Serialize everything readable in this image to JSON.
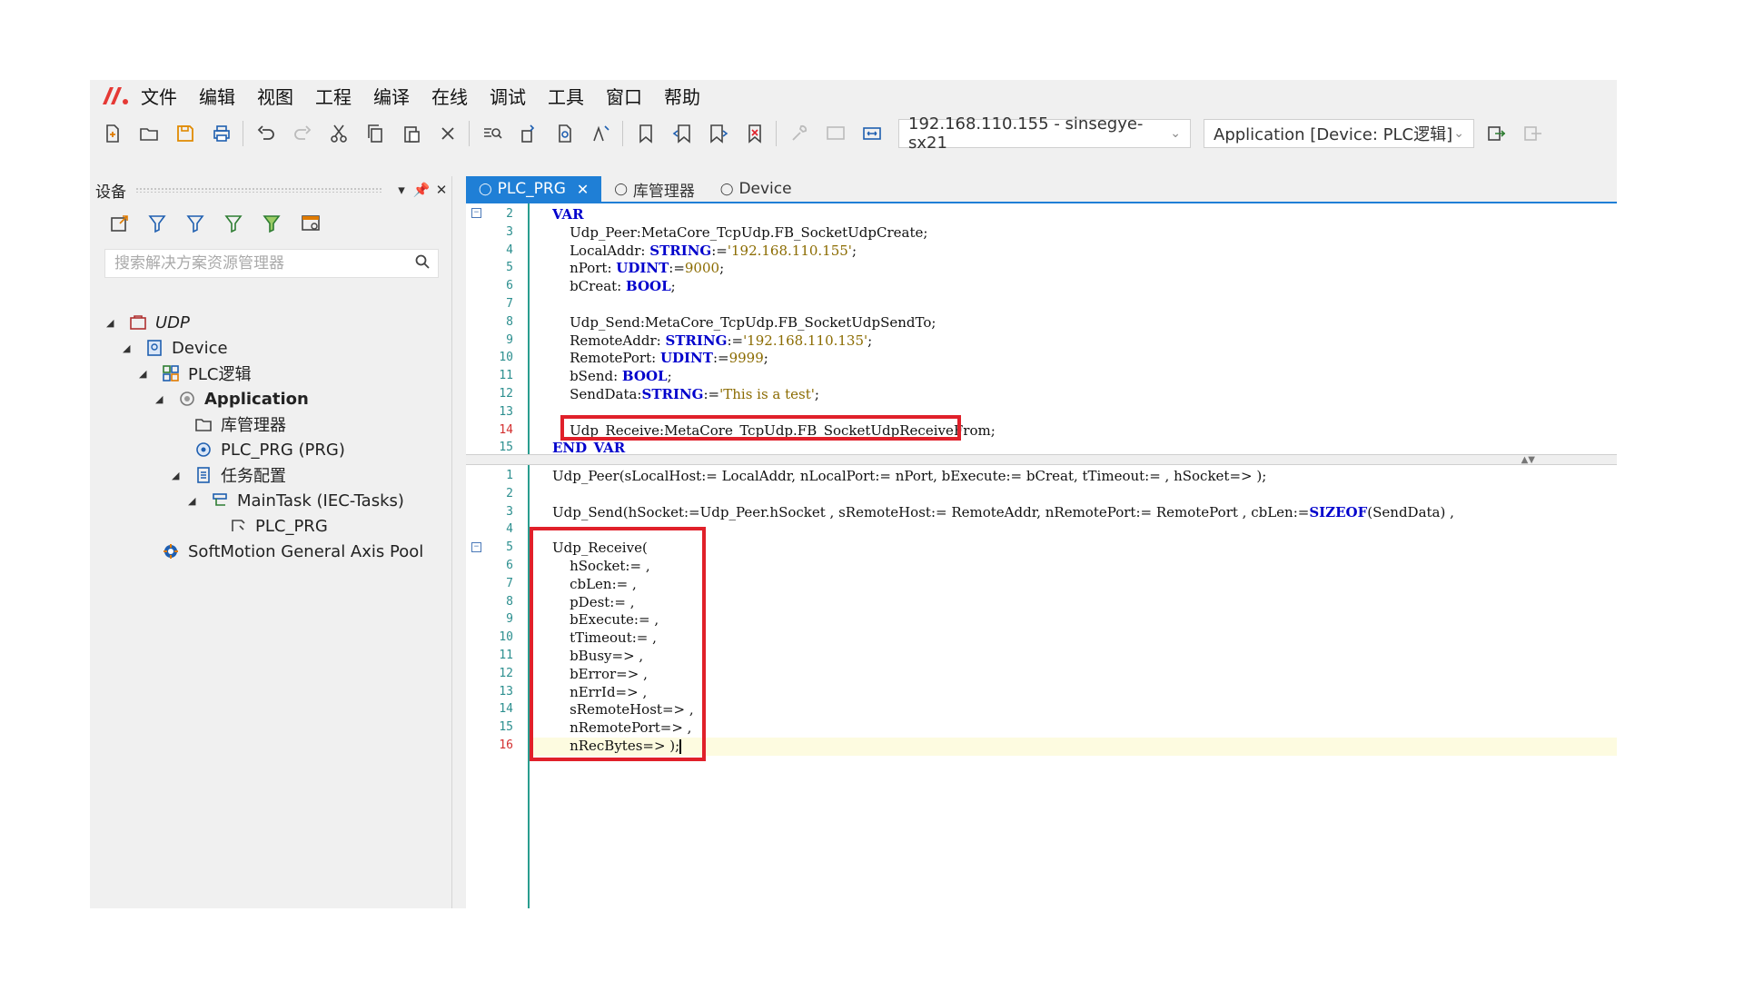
{
  "menubar": {
    "items": [
      "文件",
      "编辑",
      "视图",
      "工程",
      "编译",
      "在线",
      "调试",
      "工具",
      "窗口",
      "帮助"
    ]
  },
  "toolbar": {
    "device_combo": "192.168.110.155 - sinsegye-sx21",
    "app_combo": "Application [Device: PLC逻辑]"
  },
  "device_panel": {
    "title": "设备",
    "search_placeholder": "搜索解决方案资源管理器",
    "tree": [
      {
        "label": "UDP"
      },
      {
        "label": "Device"
      },
      {
        "label": "PLC逻辑"
      },
      {
        "label": "Application"
      },
      {
        "label": "库管理器"
      },
      {
        "label": "PLC_PRG (PRG)"
      },
      {
        "label": "任务配置"
      },
      {
        "label": "MainTask (IEC-Tasks)"
      },
      {
        "label": "PLC_PRG"
      },
      {
        "label": "SoftMotion General Axis Pool"
      }
    ]
  },
  "editor": {
    "tabs": [
      "PLC_PRG",
      "库管理器",
      "Device"
    ],
    "decl_line_numbers": [
      "2",
      "3",
      "4",
      "5",
      "6",
      "7",
      "8",
      "9",
      "10",
      "11",
      "12",
      "13",
      "14",
      "15"
    ],
    "decl_lines": [
      {
        "kw": "VAR"
      },
      {
        "text": "    Udp_Peer:MetaCore_TcpUdp.FB_SocketUdpCreate;"
      },
      {
        "text": "    LocalAddr: ",
        "kw": "STRING",
        "op": ":=",
        "lit": "'192.168.110.155'",
        "end": ";"
      },
      {
        "text": "    nPort: ",
        "kw": "UDINT",
        "op": ":=",
        "lit": "9000",
        "end": ";"
      },
      {
        "text": "    bCreat: ",
        "kw": "BOOL",
        "end": ";"
      },
      {
        "text": ""
      },
      {
        "text": "    Udp_Send:MetaCore_TcpUdp.FB_SocketUdpSendTo;"
      },
      {
        "text": "    RemoteAddr: ",
        "kw": "STRING",
        "op": ":=",
        "lit": "'192.168.110.135'",
        "end": ";"
      },
      {
        "text": "    RemotePort: ",
        "kw": "UDINT",
        "op": ":=",
        "lit": "9999",
        "end": ";"
      },
      {
        "text": "    bSend: ",
        "kw": "BOOL",
        "end": ";"
      },
      {
        "text": "    SendData:",
        "kw": "STRING",
        "op": ":=",
        "lit": "'This is a test'",
        "end": ";"
      },
      {
        "text": ""
      },
      {
        "text": "    Udp_Receive:MetaCore_TcpUdp.FB_SocketUdpReceiveFrom;"
      },
      {
        "kw": "END_VAR"
      }
    ],
    "impl_line_numbers": [
      "1",
      "2",
      "3",
      "4",
      "5",
      "6",
      "7",
      "8",
      "9",
      "10",
      "11",
      "12",
      "13",
      "14",
      "15",
      "16"
    ],
    "impl_lines": [
      "Udp_Peer(sLocalHost:= LocalAddr, nLocalPort:= nPort, bExecute:= bCreat, tTimeout:= , hSocket=> );",
      "",
      "Udp_Send(hSocket:=Udp_Peer.hSocket , sRemoteHost:= RemoteAddr, nRemotePort:= RemotePort , cbLen:=SIZEOF(SendData) ,",
      "",
      "Udp_Receive(",
      "    hSocket:= ,",
      "    cbLen:= ,",
      "    pDest:= ,",
      "    bExecute:= ,",
      "    tTimeout:= ,",
      "    bBusy=> ,",
      "    bError=> ,",
      "    nErrId=> ,",
      "    sRemoteHost=> ,",
      "    nRemotePort=> ,",
      "    nRecBytes=> );"
    ]
  },
  "colors": {
    "accent": "#1f7fd6",
    "highlight_box": "#e0202a",
    "keyword": "#0000cc",
    "literal": "#8b6b00",
    "line_number": "#2c8f8f"
  }
}
